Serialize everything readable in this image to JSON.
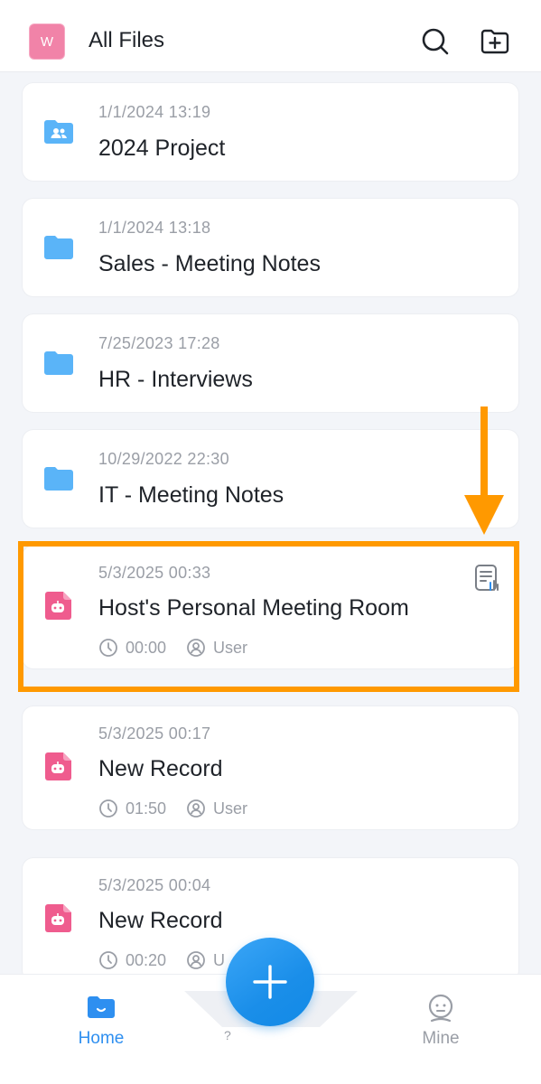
{
  "header": {
    "avatar_letter": "W",
    "title": "All Files"
  },
  "items": [
    {
      "type": "shared-folder",
      "date": "1/1/2024  13:19",
      "name": "2024 Project"
    },
    {
      "type": "folder",
      "date": "1/1/2024  13:18",
      "name": "Sales - Meeting Notes"
    },
    {
      "type": "folder",
      "date": "7/25/2023  17:28",
      "name": "HR - Interviews"
    },
    {
      "type": "folder",
      "date": "10/29/2022  22:30",
      "name": "IT - Meeting Notes"
    },
    {
      "type": "recording",
      "date": "5/3/2025  00:33",
      "name": "Host's Personal Meeting Room",
      "duration": "00:00",
      "owner": "User",
      "has_transcript": true,
      "highlighted": true
    },
    {
      "type": "recording",
      "date": "5/3/2025  00:17",
      "name": "New Record",
      "duration": "01:50",
      "owner": "User"
    },
    {
      "type": "recording",
      "date": "5/3/2025  00:04",
      "name": "New Record",
      "duration": "00:20",
      "owner": "U"
    }
  ],
  "tabbar": {
    "home_label": "Home",
    "center_label": "?",
    "mine_label": "Mine"
  },
  "colors": {
    "accent": "#2e8ff0",
    "folder": "#5ab4f8",
    "recording": "#ef5c8e",
    "highlight": "#ff9900",
    "avatar": "#f183a8"
  }
}
